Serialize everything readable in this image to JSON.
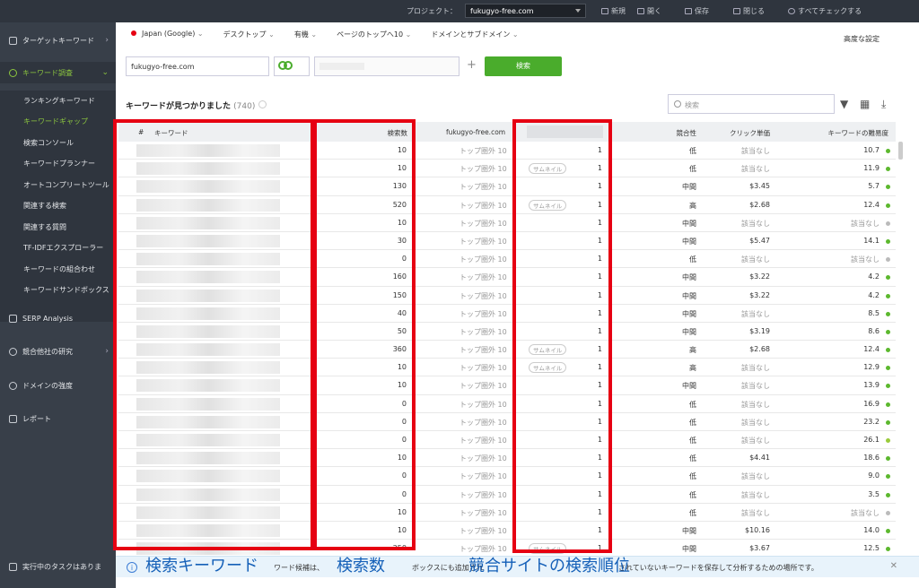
{
  "topbar": {
    "project_label": "プロジェクト：",
    "project": "fukugyo-free.com",
    "new": "新規",
    "open": "開く",
    "save": "保存",
    "close": "閉じる",
    "check_all": "すべてチェックする"
  },
  "sidebar": {
    "target_keywords": "ターゲットキーワード",
    "keyword_research": "キーワード調査",
    "sub": [
      "ランキングキーワード",
      "キーワードギャップ",
      "検索コンソール",
      "キーワードプランナー",
      "オートコンプリートツール",
      "関連する検索",
      "関連する質問",
      "TF-IDFエクスプローラー",
      "キーワードの組合わせ",
      "キーワードサンドボックス"
    ],
    "serp": "SERP Analysis",
    "competitor": "競合他社の研究",
    "domain_strength": "ドメインの強度",
    "report": "レポート",
    "task": "実行中のタスクはありま"
  },
  "filters": {
    "country": "Japan (Google)",
    "device": "デスクトップ",
    "organic": "有機",
    "pages": "ページのトップへ10",
    "domain": "ドメインとサブドメイン",
    "advanced": "高度な設定"
  },
  "inputs": {
    "domain": "fukugyo-free.com",
    "search_button": "検索",
    "add": "+"
  },
  "results": {
    "title": "キーワードが見つかりました",
    "count": "(740)",
    "search_placeholder": "検索"
  },
  "table": {
    "headers": {
      "num": "#",
      "keyword": "キーワード",
      "volume": "検索数",
      "site": "fukugyo-free.com",
      "competition": "競合性",
      "cpc": "クリック単価",
      "difficulty": "キーワードの難易度"
    },
    "rows": [
      {
        "vol": "10",
        "site": "トップ圏外 10",
        "thumb": "",
        "rank": "1",
        "comp": "低",
        "cpc": "該当なし",
        "diff": "10.7",
        "dot": "#5cb82e"
      },
      {
        "vol": "10",
        "site": "トップ圏外 10",
        "thumb": "サムネイル",
        "rank": "1",
        "comp": "低",
        "cpc": "該当なし",
        "diff": "11.9",
        "dot": "#5cb82e"
      },
      {
        "vol": "130",
        "site": "トップ圏外 10",
        "thumb": "",
        "rank": "1",
        "comp": "中間",
        "cpc": "$3.45",
        "diff": "5.7",
        "dot": "#5cb82e"
      },
      {
        "vol": "520",
        "site": "トップ圏外 10",
        "thumb": "サムネイル",
        "rank": "1",
        "comp": "高",
        "cpc": "$2.68",
        "diff": "12.4",
        "dot": "#5cb82e"
      },
      {
        "vol": "10",
        "site": "トップ圏外 10",
        "thumb": "",
        "rank": "1",
        "comp": "中間",
        "cpc": "該当なし",
        "diff": "該当なし",
        "dot": "#bbbbbb"
      },
      {
        "vol": "30",
        "site": "トップ圏外 10",
        "thumb": "",
        "rank": "1",
        "comp": "中間",
        "cpc": "$5.47",
        "diff": "14.1",
        "dot": "#5cb82e"
      },
      {
        "vol": "0",
        "site": "トップ圏外 10",
        "thumb": "",
        "rank": "1",
        "comp": "低",
        "cpc": "該当なし",
        "diff": "該当なし",
        "dot": "#bbbbbb"
      },
      {
        "vol": "160",
        "site": "トップ圏外 10",
        "thumb": "",
        "rank": "1",
        "comp": "中間",
        "cpc": "$3.22",
        "diff": "4.2",
        "dot": "#5cb82e"
      },
      {
        "vol": "150",
        "site": "トップ圏外 10",
        "thumb": "",
        "rank": "1",
        "comp": "中間",
        "cpc": "$3.22",
        "diff": "4.2",
        "dot": "#5cb82e"
      },
      {
        "vol": "40",
        "site": "トップ圏外 10",
        "thumb": "",
        "rank": "1",
        "comp": "中間",
        "cpc": "該当なし",
        "diff": "8.5",
        "dot": "#5cb82e"
      },
      {
        "vol": "50",
        "site": "トップ圏外 10",
        "thumb": "",
        "rank": "1",
        "comp": "中間",
        "cpc": "$3.19",
        "diff": "8.6",
        "dot": "#5cb82e"
      },
      {
        "vol": "360",
        "site": "トップ圏外 10",
        "thumb": "サムネイル",
        "rank": "1",
        "comp": "高",
        "cpc": "$2.68",
        "diff": "12.4",
        "dot": "#5cb82e"
      },
      {
        "vol": "10",
        "site": "トップ圏外 10",
        "thumb": "サムネイル",
        "rank": "1",
        "comp": "高",
        "cpc": "該当なし",
        "diff": "12.9",
        "dot": "#5cb82e"
      },
      {
        "vol": "10",
        "site": "トップ圏外 10",
        "thumb": "",
        "rank": "1",
        "comp": "中間",
        "cpc": "該当なし",
        "diff": "13.9",
        "dot": "#5cb82e"
      },
      {
        "vol": "0",
        "site": "トップ圏外 10",
        "thumb": "",
        "rank": "1",
        "comp": "低",
        "cpc": "該当なし",
        "diff": "16.9",
        "dot": "#5cb82e"
      },
      {
        "vol": "0",
        "site": "トップ圏外 10",
        "thumb": "",
        "rank": "1",
        "comp": "低",
        "cpc": "該当なし",
        "diff": "23.2",
        "dot": "#5cb82e"
      },
      {
        "vol": "0",
        "site": "トップ圏外 10",
        "thumb": "",
        "rank": "1",
        "comp": "低",
        "cpc": "該当なし",
        "diff": "26.1",
        "dot": "#9acb3b"
      },
      {
        "vol": "10",
        "site": "トップ圏外 10",
        "thumb": "",
        "rank": "1",
        "comp": "低",
        "cpc": "$4.41",
        "diff": "18.6",
        "dot": "#5cb82e"
      },
      {
        "vol": "0",
        "site": "トップ圏外 10",
        "thumb": "",
        "rank": "1",
        "comp": "低",
        "cpc": "該当なし",
        "diff": "9.0",
        "dot": "#5cb82e"
      },
      {
        "vol": "0",
        "site": "トップ圏外 10",
        "thumb": "",
        "rank": "1",
        "comp": "低",
        "cpc": "該当なし",
        "diff": "3.5",
        "dot": "#5cb82e"
      },
      {
        "vol": "10",
        "site": "トップ圏外 10",
        "thumb": "",
        "rank": "1",
        "comp": "低",
        "cpc": "該当なし",
        "diff": "該当なし",
        "dot": "#bbbbbb"
      },
      {
        "vol": "10",
        "site": "トップ圏外 10",
        "thumb": "",
        "rank": "1",
        "comp": "中間",
        "cpc": "$10.16",
        "diff": "14.0",
        "dot": "#5cb82e"
      },
      {
        "vol": "250",
        "site": "トップ圏外 10",
        "thumb": "サムネイル",
        "rank": "1",
        "comp": "中間",
        "cpc": "$3.67",
        "diff": "12.5",
        "dot": "#5cb82e"
      }
    ]
  },
  "info": {
    "text_left": "ワード候補は、",
    "text_mid": "ボックスにも追加され",
    "text_right": "されていないキーワードを保存して分析するための場所です。"
  },
  "annotations": {
    "keyword": "検索キーワード",
    "volume": "検索数",
    "rank": "競合サイトの検索順位"
  },
  "colors": {
    "accent": "#8cc63f",
    "button": "#4aac2c",
    "highlight": "#e60012",
    "annotation_text": "#1560b8"
  }
}
